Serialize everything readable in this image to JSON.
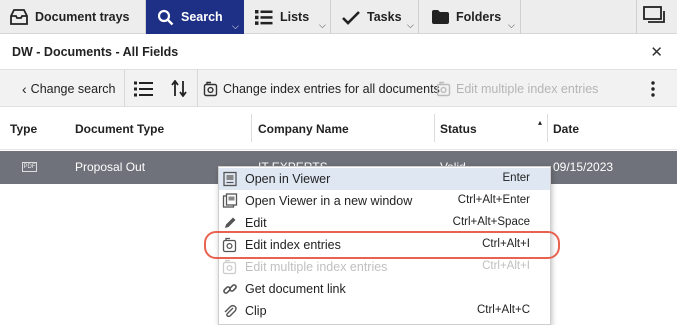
{
  "topbar": {
    "document_trays": "Document trays",
    "search": "Search",
    "lists": "Lists",
    "tasks": "Tasks",
    "folders": "Folders"
  },
  "titlebar": {
    "title": "DW - Documents - All Fields"
  },
  "toolbar": {
    "change_search": "Change search",
    "change_index_all": "Change index entries for all documents",
    "edit_multiple": "Edit multiple index entries"
  },
  "grid": {
    "columns": [
      "Type",
      "Document Type",
      "Company Name",
      "Status",
      "Date"
    ],
    "rows": [
      {
        "type_icon": "PDF",
        "document_type": "Proposal Out",
        "company_name": "IT EXPERTS",
        "status": "Valid",
        "date": "09/15/2023"
      }
    ]
  },
  "context_menu": {
    "items": [
      {
        "label": "Open in Viewer",
        "shortcut": "Enter",
        "icon": "viewer-icon",
        "state": "hovered"
      },
      {
        "label": "Open Viewer in a new window",
        "shortcut": "Ctrl+Alt+Enter",
        "icon": "new-window-icon",
        "state": "normal"
      },
      {
        "label": "Edit",
        "shortcut": "Ctrl+Alt+Space",
        "icon": "pencil-icon",
        "state": "normal"
      },
      {
        "label": "Edit index entries",
        "shortcut": "Ctrl+Alt+I",
        "icon": "index-entries-icon",
        "state": "highlighted"
      },
      {
        "label": "Edit multiple index entries",
        "shortcut": "Ctrl+Alt+I",
        "icon": "multi-index-icon",
        "state": "disabled"
      },
      {
        "label": "Get document link",
        "shortcut": "",
        "icon": "link-icon",
        "state": "normal"
      },
      {
        "label": "Clip",
        "shortcut": "Ctrl+Alt+C",
        "icon": "paperclip-icon",
        "state": "normal"
      }
    ]
  },
  "colors": {
    "search_tab_bg": "#1e2f86",
    "selected_row_bg": "#6f727a",
    "menu_hover_bg": "#dfe7f3",
    "callout_ring": "#e8624f"
  }
}
